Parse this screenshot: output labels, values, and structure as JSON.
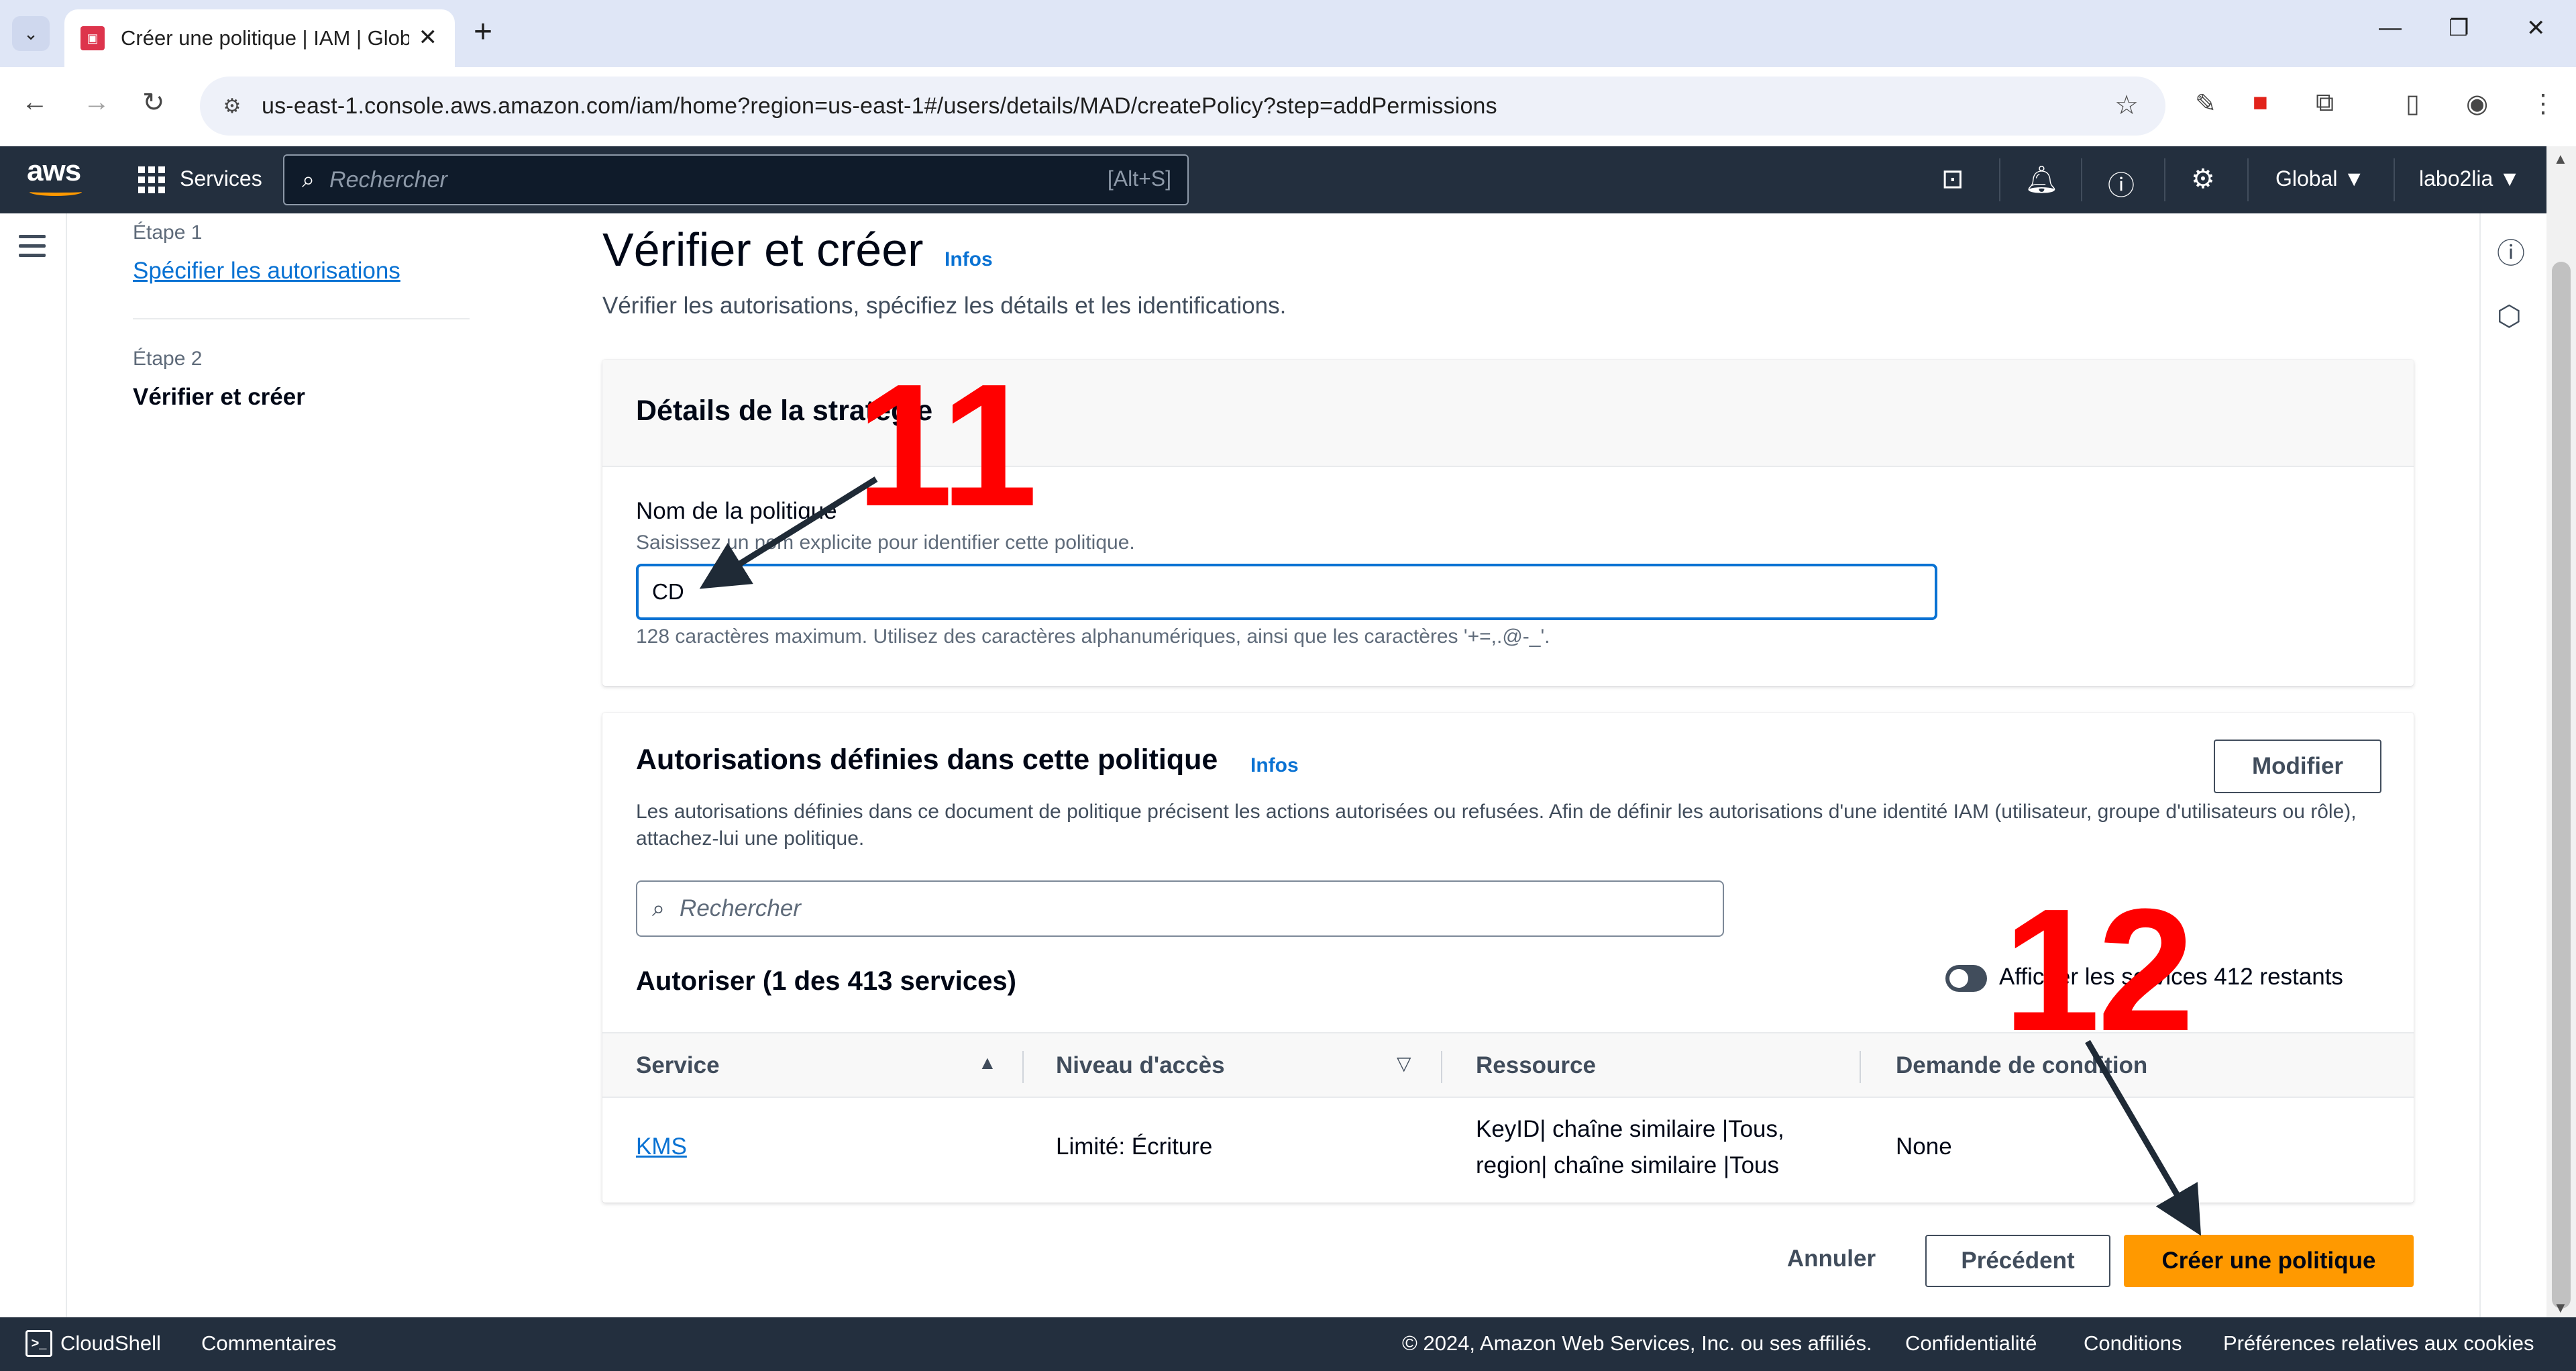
{
  "browser": {
    "tab_title": "Créer une politique | IAM | Glob",
    "url": "us-east-1.console.aws.amazon.com/iam/home?region=us-east-1#/users/details/MAD/createPolicy?step=addPermissions"
  },
  "aws_nav": {
    "logo": "aws",
    "services_label": "Services",
    "search_placeholder": "Rechercher",
    "search_shortcut": "[Alt+S]",
    "region": "Global ▼",
    "account": "labo2lia ▼"
  },
  "sidebar": {
    "step1_label": "Étape 1",
    "step1_link": "Spécifier les autorisations",
    "step2_label": "Étape 2",
    "step2_current": "Vérifier et créer"
  },
  "page": {
    "title": "Vérifier et créer",
    "info": "Infos",
    "description": "Vérifier les autorisations, spécifiez les détails et les identifications."
  },
  "details_card": {
    "title": "Détails de la stratégie",
    "name_label": "Nom de la politique",
    "name_help": "Saisissez un nom explicite pour identifier cette politique.",
    "name_value": "CD",
    "constraint": "128 caractères maximum. Utilisez des caractères alphanumériques, ainsi que les caractères '+=,.@-_'."
  },
  "permissions_card": {
    "title": "Autorisations définies dans cette politique",
    "info": "Infos",
    "edit_button": "Modifier",
    "description": "Les autorisations définies dans ce document de politique précisent les actions autorisées ou refusées. Afin de définir les autorisations d'une identité IAM (utilisateur, groupe d'utilisateurs ou rôle), attachez-lui une politique.",
    "search_placeholder": "Rechercher",
    "allow_title": "Autoriser (1 des 413 services)",
    "toggle_label": "Afficher les services 412 restants",
    "columns": [
      "Service",
      "Niveau d'accès",
      "Ressource",
      "Demande de condition"
    ],
    "rows": [
      {
        "service": "KMS",
        "access": "Limité: Écriture",
        "resource_line1": "KeyID| chaîne similaire |Tous,",
        "resource_line2": "region| chaîne similaire |Tous",
        "condition": "None"
      }
    ]
  },
  "actions": {
    "cancel": "Annuler",
    "previous": "Précédent",
    "create": "Créer une politique"
  },
  "footer": {
    "cloudshell": "CloudShell",
    "feedback": "Commentaires",
    "copyright": "© 2024, Amazon Web Services, Inc. ou ses affiliés.",
    "privacy": "Confidentialité",
    "terms": "Conditions",
    "cookies": "Préférences relatives aux cookies"
  },
  "annotations": {
    "step_a": "11",
    "step_b": "12"
  },
  "colors": {
    "aws_nav": "#232f3e",
    "link": "#0972d3",
    "primary_button": "#ff9900",
    "annotation": "#ff0000"
  }
}
